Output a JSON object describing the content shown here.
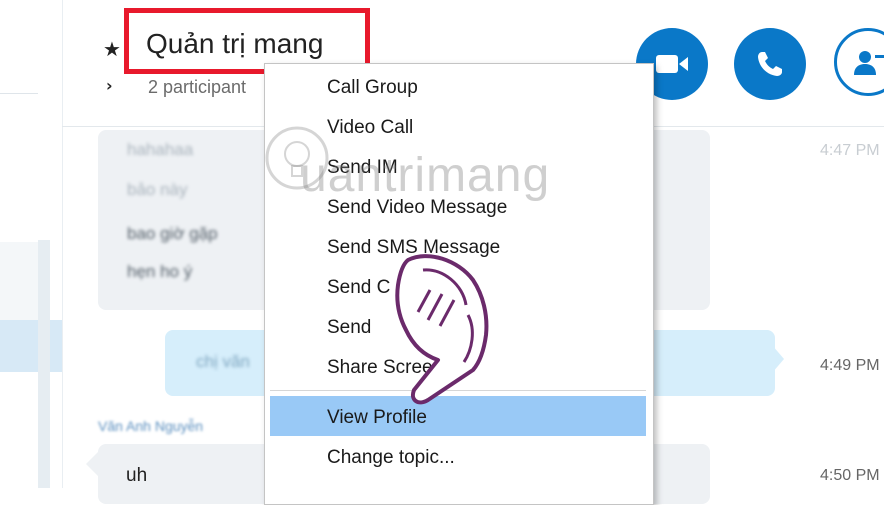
{
  "conversation": {
    "title": "Quản trị mang",
    "participants": "2 participant"
  },
  "messages": {
    "m1_line1": "hahahaa",
    "m1_line2": "bảo này",
    "m1_line3": "bao giờ gặp",
    "m1_line4": "hẹn ho ý",
    "m2": "chị văn",
    "sender": "Văn Anh Nguyễn",
    "m3": "uh"
  },
  "times": {
    "t1": "4:47 PM",
    "t2": "4:49 PM",
    "t3": "4:50 PM"
  },
  "context_menu": {
    "items": [
      "Call Group",
      "Video Call",
      "Send IM",
      "Send Video Message",
      "Send SMS Message",
      "Send C",
      "Send",
      "Share Screens...",
      "View Profile",
      "Change topic..."
    ],
    "highlighted": "View Profile"
  },
  "watermark": "uantrimang",
  "colors": {
    "accent": "#0a78c8",
    "highlight_box": "#e8192c",
    "menu_highlight": "#99c9f6",
    "hand": "#6b2a6b"
  },
  "icons": {
    "video": "video-camera-icon",
    "call": "phone-icon",
    "add": "add-participant-icon",
    "star": "star-icon",
    "chevron": "chevron-right-icon"
  }
}
